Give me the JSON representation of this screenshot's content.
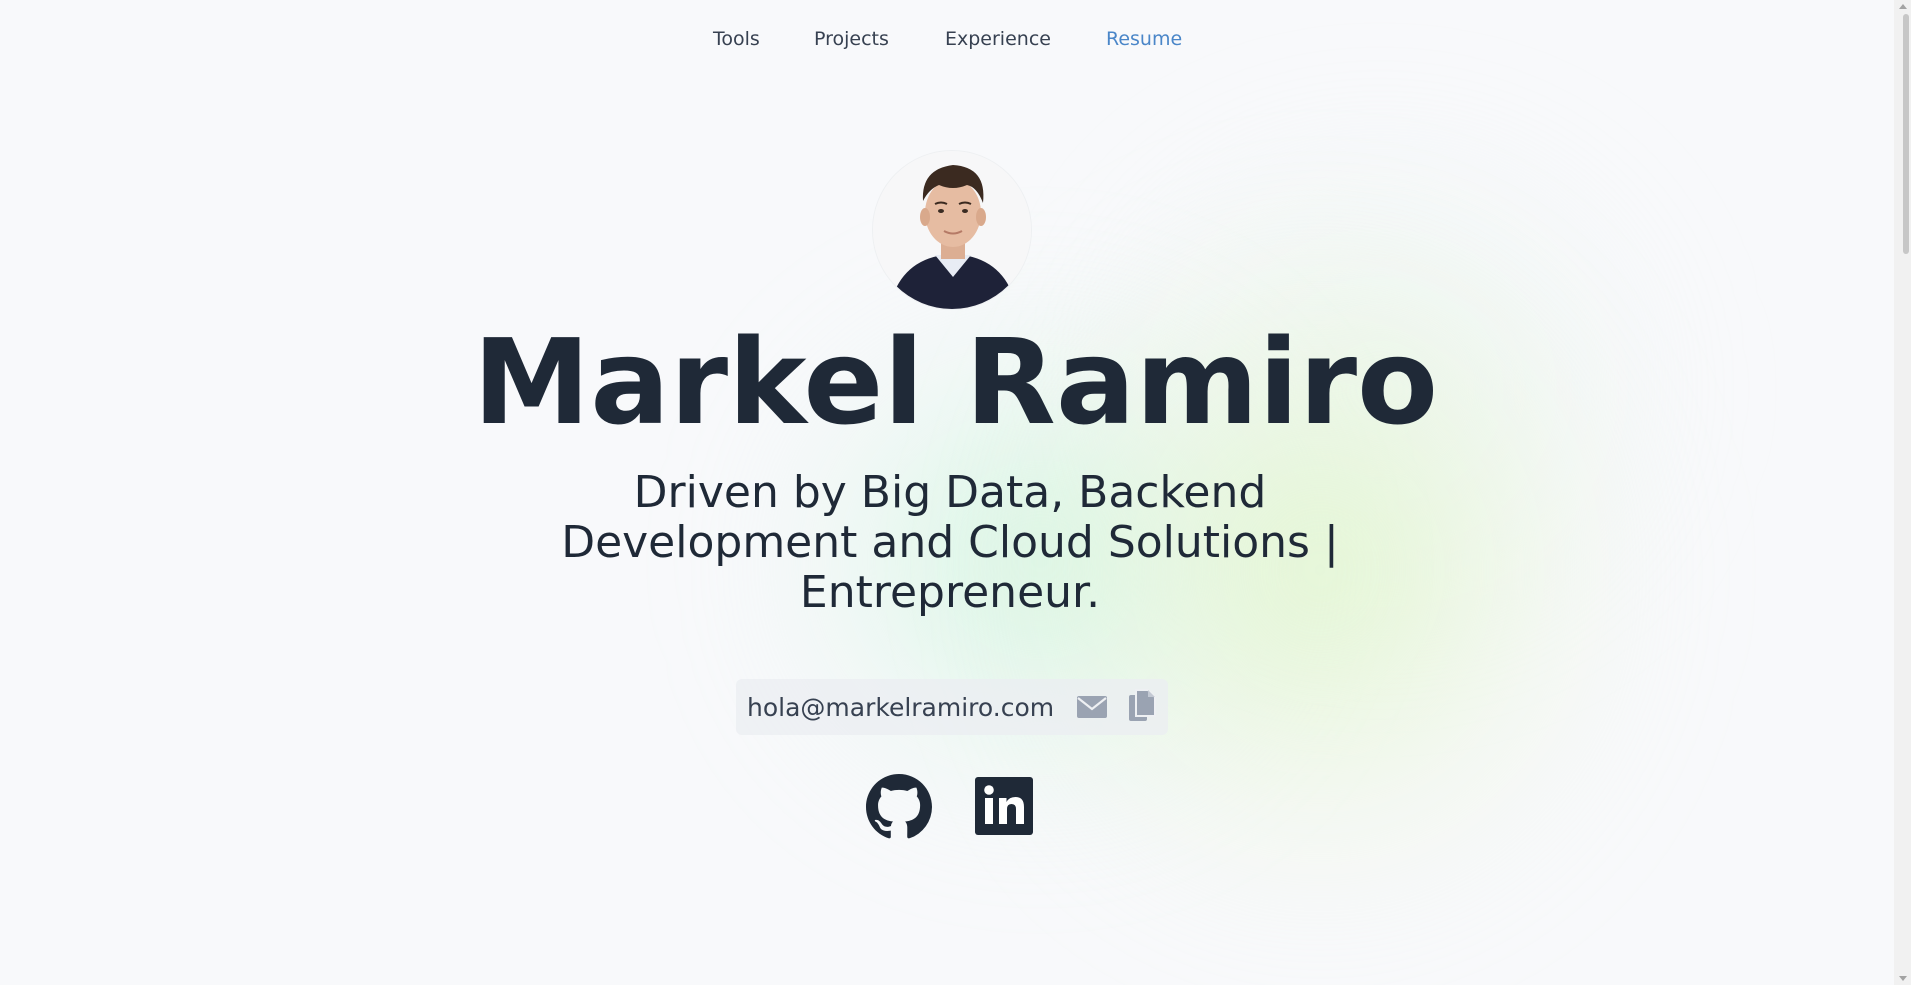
{
  "nav": {
    "items": [
      {
        "label": "Tools"
      },
      {
        "label": "Projects"
      },
      {
        "label": "Experience"
      },
      {
        "label": "Resume"
      }
    ]
  },
  "hero": {
    "name": "Markel Ramiro",
    "tagline": "Driven by Big Data, Backend Development and Cloud Solutions | Entrepreneur.",
    "email": "hola@markelramiro.com"
  },
  "icons": {
    "email": "envelope-icon",
    "copy": "copy-icon",
    "github": "github-icon",
    "linkedin": "linkedin-icon"
  },
  "colors": {
    "text": "#1f2937",
    "accent": "#4a86c8",
    "icon_muted": "#9aa3b2"
  }
}
